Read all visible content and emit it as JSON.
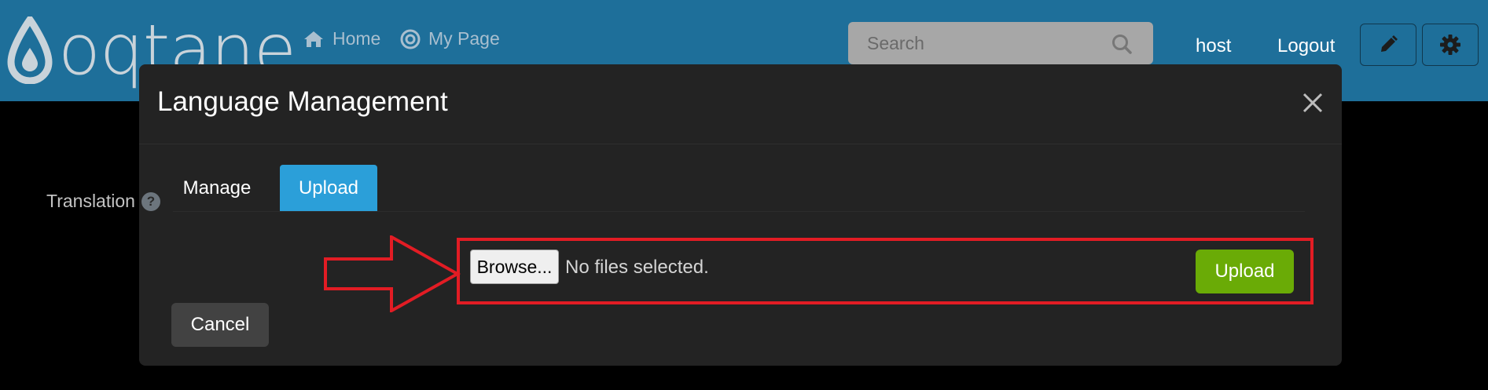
{
  "brand": {
    "logo_text": "oqtane"
  },
  "nav": {
    "home": "Home",
    "my_page": "My Page"
  },
  "search": {
    "placeholder": "Search"
  },
  "user": {
    "name": "host",
    "logout": "Logout"
  },
  "modal": {
    "title": "Language Management",
    "tabs": [
      {
        "label": "Manage",
        "active": false
      },
      {
        "label": "Upload",
        "active": true
      }
    ],
    "translation_label": "Translation",
    "browse_label": "Browse...",
    "file_status": "No files selected.",
    "upload_label": "Upload",
    "cancel_label": "Cancel"
  },
  "icons": [
    "logo-drop-icon",
    "home-icon",
    "target-icon",
    "search-icon",
    "pencil-icon",
    "gear-icon",
    "close-icon",
    "help-icon"
  ],
  "colors": {
    "navbar": "#1e6f9a",
    "modal_bg": "#232323",
    "tab_active": "#2b9fd9",
    "upload_button": "#6aab06",
    "annotation": "#e21c24"
  }
}
